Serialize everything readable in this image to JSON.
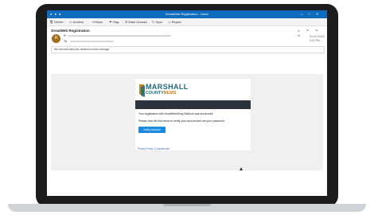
{
  "window": {
    "title": "GreatWeb Registration - Inbox",
    "controls": [
      "—",
      "□",
      "✕"
    ]
  },
  "toolbar": {
    "items": [
      {
        "icon": "trash-icon",
        "glyph": "🗑",
        "label": "Delete"
      },
      {
        "icon": "archive-icon",
        "glyph": "▭",
        "label": "Archive"
      },
      {
        "icon": "move-icon",
        "glyph": "⇥",
        "label": "Move"
      },
      {
        "icon": "flag-icon",
        "glyph": "⚑",
        "label": "Flag"
      },
      {
        "icon": "mail-icon",
        "glyph": "✉",
        "label": "Mark Unread"
      },
      {
        "icon": "sync-icon",
        "glyph": "↻",
        "label": "Sync"
      },
      {
        "icon": "report-icon",
        "glyph": "⚠",
        "label": "Report"
      }
    ]
  },
  "email": {
    "subject": "GreatWeb Registration",
    "header_icons": "☺ ↶ ↷ ⇥",
    "avatar_initial": "R",
    "sender_prefix": "R",
    "to_prefix": "To",
    "date": "Fri 6/7/2024 3:22 PM",
    "info_bar": "We removed extra line breaks from this message."
  },
  "content": {
    "logo_line1": "MARSHALL",
    "logo_line2a": "COUNTY",
    "logo_line2b": "BEMS",
    "message_line1": "Your registration with GreatWeb/Greg Stations was successful.",
    "message_line2": "Please click the link below to verify your account and set your password.",
    "verify_button": "Verify Account",
    "privacy_link": "Privacy Policy | Unsubscribe"
  },
  "colors": {
    "titlebar": "#0f6cbd",
    "logo_teal": "#1e6d7a",
    "logo_accent": "#c8841b",
    "banner": "#2b343d",
    "button": "#1a8be0"
  }
}
